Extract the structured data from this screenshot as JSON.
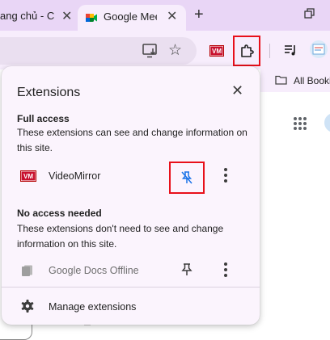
{
  "tabs": [
    {
      "title": "ang chủ - C",
      "active": false
    },
    {
      "title": "Google Mee",
      "active": true
    }
  ],
  "bookmarks_bar": {
    "all_bookmarks": "All Booki"
  },
  "popup": {
    "title": "Extensions",
    "full_access": {
      "heading": "Full access",
      "description": "These extensions can see and change information on this site.",
      "extensions": [
        {
          "name": "VideoMirror",
          "icon": "videomirror-icon",
          "pinned": false
        }
      ]
    },
    "no_access": {
      "heading": "No access needed",
      "description": "These extensions don't need to see and change information on this site.",
      "extensions": [
        {
          "name": "Google Docs Offline",
          "icon": "google-docs-offline-icon",
          "pinned": false
        }
      ]
    },
    "manage_label": "Manage extensions"
  },
  "colors": {
    "tab_strip": "#e9d6f6",
    "toolbar": "#f7edfc",
    "popup_bg": "#fbf4fd",
    "highlight": "#e8101a"
  }
}
